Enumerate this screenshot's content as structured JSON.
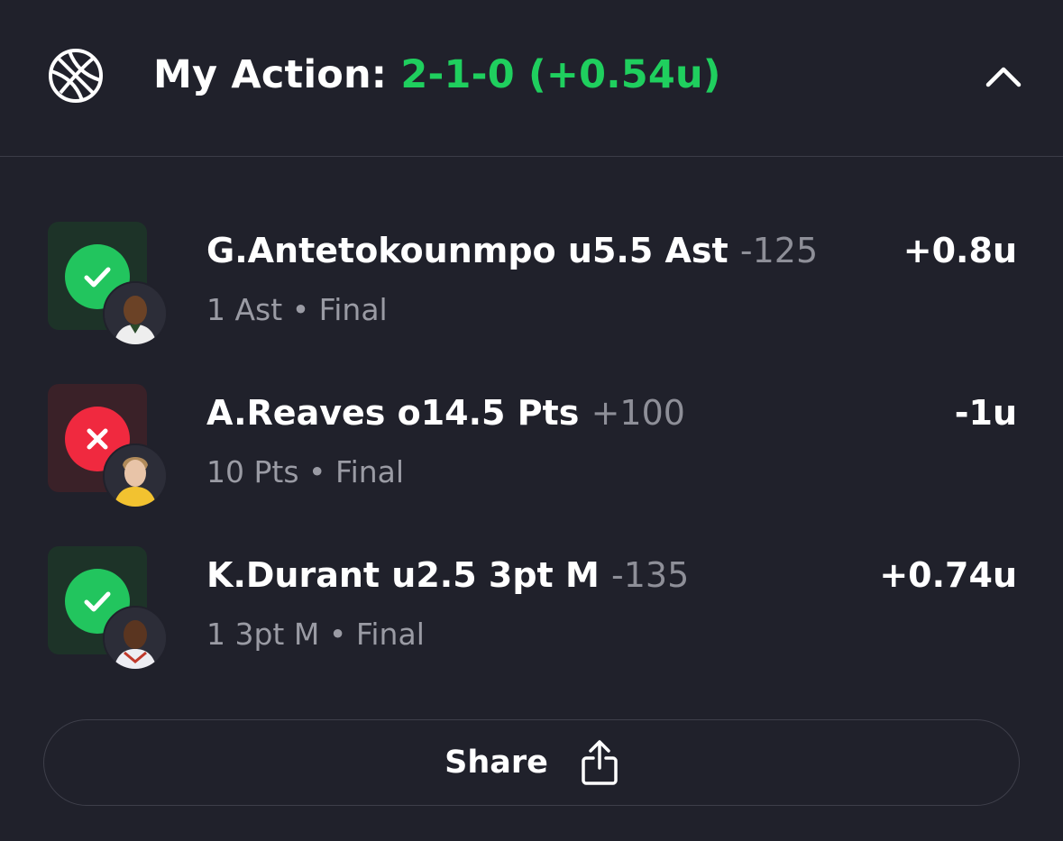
{
  "header": {
    "title_prefix": "My Action: ",
    "record": "2-1-0 (+0.54u)",
    "sport_icon": "basketball-icon",
    "collapse_icon": "chevron-up-icon"
  },
  "colors": {
    "background": "#20212b",
    "win": "#22c55e",
    "loss": "#f0293f",
    "record_green": "#1fcf5e",
    "muted_text": "#9a9ba4"
  },
  "bets": [
    {
      "status": "win",
      "status_icon": "checkmark-icon",
      "player_name": "G.Antetokounmpo u5.5 Ast",
      "odds": "-125",
      "stat": "1 Ast",
      "state": "Final",
      "result": "+0.8u"
    },
    {
      "status": "loss",
      "status_icon": "x-mark-icon",
      "player_name": "A.Reaves o14.5 Pts",
      "odds": "+100",
      "stat": "10 Pts",
      "state": "Final",
      "result": "-1u"
    },
    {
      "status": "win",
      "status_icon": "checkmark-icon",
      "player_name": "K.Durant u2.5 3pt M",
      "odds": "-135",
      "stat": "1 3pt M",
      "state": "Final",
      "result": "+0.74u"
    }
  ],
  "share": {
    "label": "Share",
    "icon": "share-icon"
  },
  "separator": "•"
}
